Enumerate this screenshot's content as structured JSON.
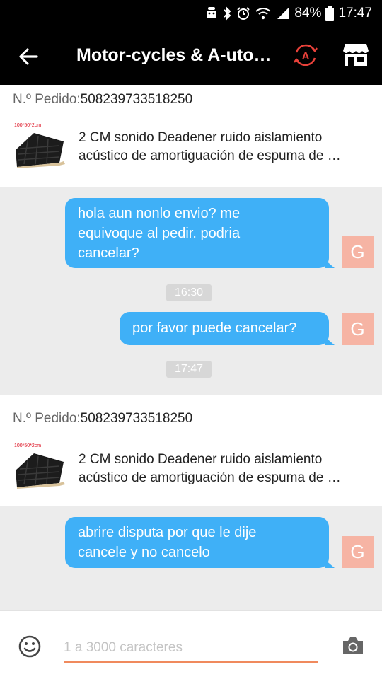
{
  "status_bar": {
    "battery_text": "84%",
    "time": "17:47",
    "icons": [
      "android-icon",
      "bluetooth-icon",
      "alarm-icon",
      "wifi-icon",
      "signal-icon",
      "battery-icon"
    ]
  },
  "app_bar": {
    "title": "Motor-cycles & A-uto…",
    "brand_badge_letter": "A",
    "accent_color": "#e8413a"
  },
  "orders": [
    {
      "label": "N.º Pedido:",
      "number": "508239733518250",
      "image_caption": "100*50*2cm",
      "line1": "2 CM sonido Deadener ruido aislamiento",
      "line2": "acústico de amortiguación de espuma de …"
    },
    {
      "label": "N.º Pedido:",
      "number": "508239733518250",
      "image_caption": "100*50*2cm",
      "line1": "2 CM sonido Deadener ruido aislamiento",
      "line2": "acústico de amortiguación de espuma de …"
    }
  ],
  "messages": [
    {
      "lines": [
        "hola aun nonlo envio? me",
        "equivoque al pedir. podria",
        "cancelar?"
      ],
      "avatar": "G"
    },
    {
      "timestamp": "16:30"
    },
    {
      "lines": [
        "por favor puede cancelar?"
      ],
      "avatar": "G"
    },
    {
      "timestamp": "17:47"
    },
    {
      "lines": [
        "abrire disputa por que le dije",
        "cancele y no cancelo"
      ],
      "avatar": "G"
    }
  ],
  "input": {
    "placeholder": "1 a 3000 caracteres",
    "value": ""
  },
  "colors": {
    "bubble": "#3fb0f7",
    "avatar_bg": "#f6b4a4",
    "input_underline": "#f08a5d",
    "chat_bg": "#ececec"
  }
}
